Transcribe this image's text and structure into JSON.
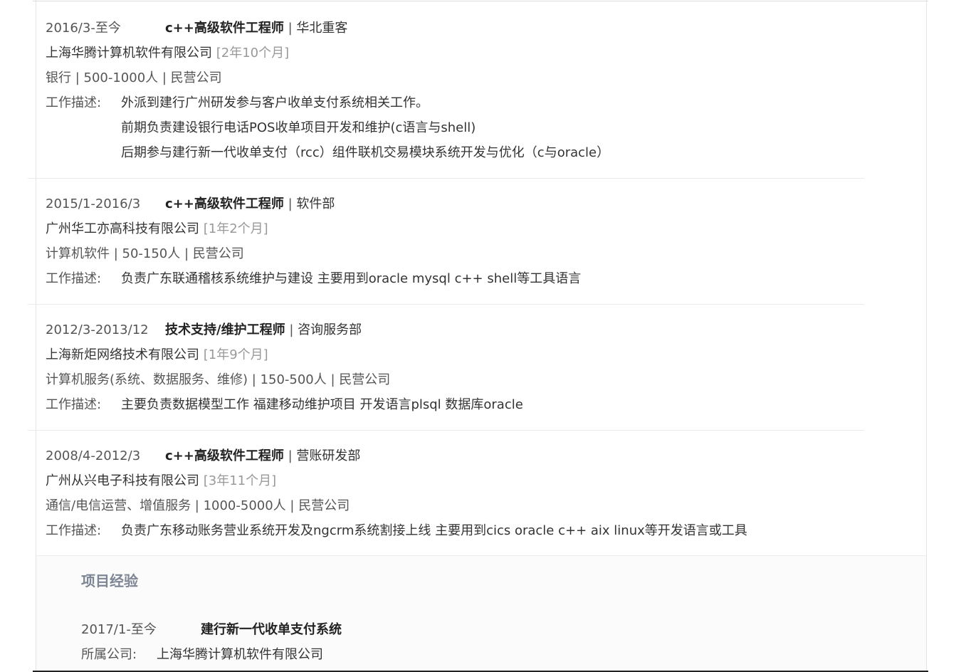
{
  "work_experience": [
    {
      "period": "2016/3-至今",
      "title": "c++高级软件工程师",
      "department": "华北重客",
      "company": "上海华腾计算机软件有限公司",
      "duration": "[2年10个月]",
      "industry": "银行 | 500-1000人 | 民营公司",
      "desc_label": "工作描述:",
      "desc_lines": [
        "外派到建行广州研发参与客户收单支付系统相关工作。",
        "前期负责建设银行电话POS收单项目开发和维护(c语言与shell)",
        "后期参与建行新一代收单支付（rcc）组件联机交易模块系统开发与优化（c与oracle）"
      ]
    },
    {
      "period": "2015/1-2016/3",
      "title": "c++高级软件工程师",
      "department": "软件部",
      "company": "广州华工亦高科技有限公司",
      "duration": "[1年2个月]",
      "industry": "计算机软件 | 50-150人 | 民营公司",
      "desc_label": "工作描述:",
      "desc_lines": [
        "负责广东联通稽核系统维护与建设 主要用到oracle mysql c++ shell等工具语言"
      ]
    },
    {
      "period": "2012/3-2013/12",
      "title": "技术支持/维护工程师",
      "department": "咨询服务部",
      "company": "上海新炬网络技术有限公司",
      "duration": "[1年9个月]",
      "industry": "计算机服务(系统、数据服务、维修) | 150-500人 | 民营公司",
      "desc_label": "工作描述:",
      "desc_lines": [
        "主要负责数据模型工作 福建移动维护项目 开发语言plsql 数据库oracle"
      ]
    },
    {
      "period": "2008/4-2012/3",
      "title": "c++高级软件工程师",
      "department": "营账研发部",
      "company": "广州从兴电子科技有限公司",
      "duration": "[3年11个月]",
      "industry": "通信/电信运营、增值服务 | 1000-5000人 | 民营公司",
      "desc_label": "工作描述:",
      "desc_lines": [
        "负责广东移动账务营业系统开发及ngcrm系统割接上线 主要用到cics oracle c++ aix linux等开发语言或工具"
      ]
    }
  ],
  "project_section": {
    "heading": "项目经验",
    "items": [
      {
        "period": "2017/1-至今",
        "name": "建行新一代收单支付系统",
        "company_label": "所属公司:",
        "company": "上海华腾计算机软件有限公司"
      }
    ]
  },
  "separator": "|"
}
